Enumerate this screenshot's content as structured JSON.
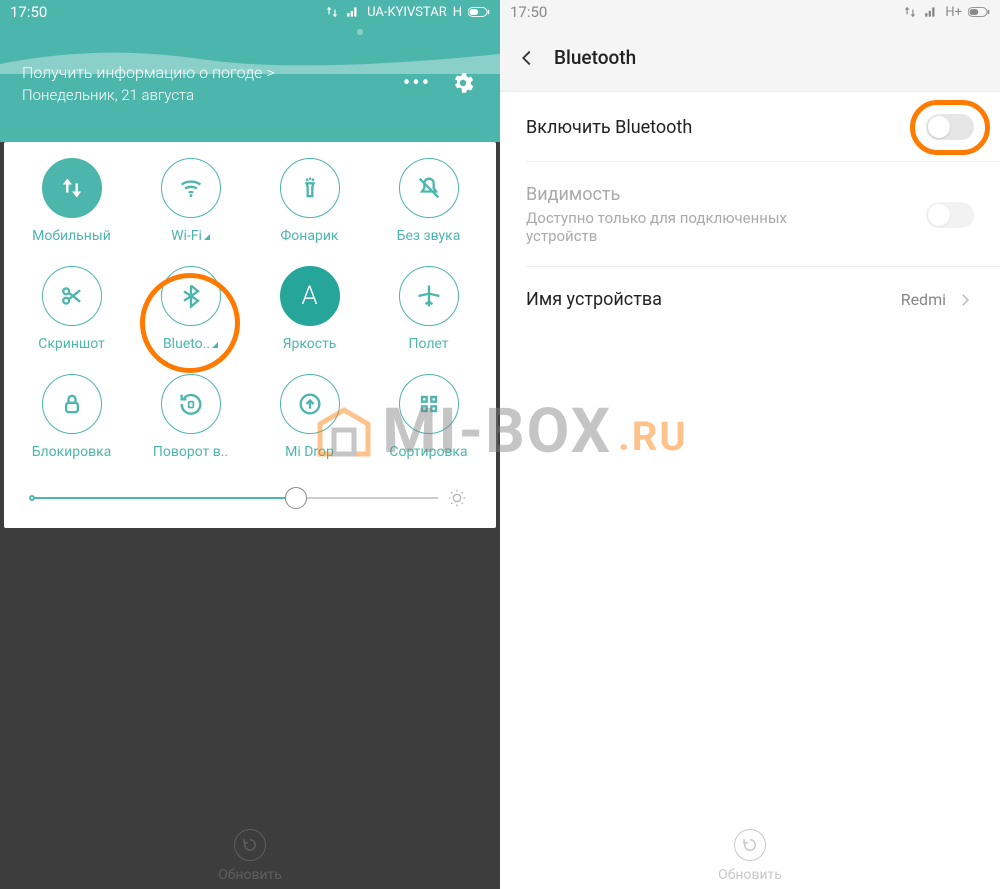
{
  "left": {
    "status": {
      "time": "17:50",
      "carrier": "UA-KYIVSTAR",
      "net": "H"
    },
    "weather": {
      "title": "Получить информацию о погоде >",
      "date": "Понедельник, 21 августа"
    },
    "tiles": [
      {
        "id": "mobile-data",
        "label": "Мобильный",
        "active": true
      },
      {
        "id": "wifi",
        "label": "Wi-Fi",
        "expand": true
      },
      {
        "id": "flashlight",
        "label": "Фонарик"
      },
      {
        "id": "mute",
        "label": "Без звука"
      },
      {
        "id": "screenshot",
        "label": "Скриншот"
      },
      {
        "id": "bluetooth",
        "label": "Blueto..",
        "expand": true,
        "highlight": true
      },
      {
        "id": "brightness",
        "label": "Яркость",
        "brightness": true,
        "letter": "A"
      },
      {
        "id": "airplane",
        "label": "Полет"
      },
      {
        "id": "lock",
        "label": "Блокировка"
      },
      {
        "id": "rotation",
        "label": "Поворот в.."
      },
      {
        "id": "midrop",
        "label": "Mi Drop"
      },
      {
        "id": "edit",
        "label": "Сортировка"
      }
    ],
    "refresh_label": "Обновить"
  },
  "right": {
    "status": {
      "time": "17:50",
      "net": "H+"
    },
    "header": "Bluetooth",
    "rows": {
      "enable": {
        "title": "Включить Bluetooth"
      },
      "visibility": {
        "title": "Видимость",
        "subtitle": "Доступно только для подключенных устройств"
      },
      "device": {
        "title": "Имя устройства",
        "value": "Redmi"
      }
    },
    "refresh_label": "Обновить"
  },
  "watermark": {
    "text": "MI-BOX",
    "suffix": ".RU"
  },
  "colors": {
    "teal": "#4db6ac",
    "orange": "#ff7a00"
  }
}
